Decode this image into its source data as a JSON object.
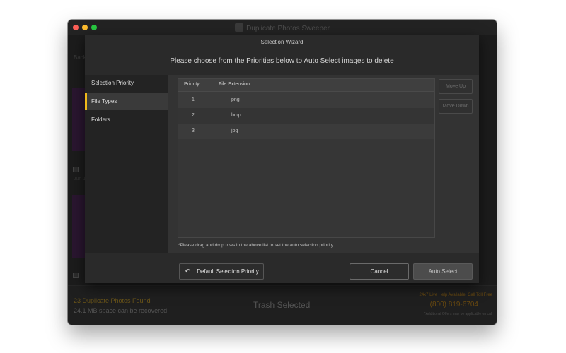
{
  "window": {
    "app_title": "Duplicate Photos Sweeper"
  },
  "background": {
    "back_label": "Back",
    "date_label": "Jun 1",
    "footer": {
      "found": "23 Duplicate Photos Found",
      "space": "24.1 MB space can be recovered",
      "trash": "Trash Selected",
      "help": "24x7 Live Help Available, Call Toll Free",
      "phone": "(800) 819-6704",
      "offer": "*Additional Offers may be applicable on call"
    }
  },
  "wizard": {
    "title": "Selection Wizard",
    "heading": "Please choose from the Priorities below to Auto Select images to delete",
    "sidebar_items": [
      {
        "label": "Selection Priority"
      },
      {
        "label": "File Types"
      },
      {
        "label": "Folders"
      }
    ],
    "active_item": "File Types",
    "table": {
      "headers": [
        "Priority",
        "File Extension"
      ],
      "rows": [
        {
          "priority": "1",
          "ext": "png"
        },
        {
          "priority": "2",
          "ext": "bmp"
        },
        {
          "priority": "3",
          "ext": "jpg"
        }
      ]
    },
    "move_up_label": "Move Up",
    "move_down_label": "Move Down",
    "note": "*Please drag and drop rows in the above list to set the auto selection priority",
    "default_priority_label": "Default Selection Priority",
    "cancel_label": "Cancel",
    "auto_select_label": "Auto Select"
  },
  "colors": {
    "accent": "#f0b81a",
    "close": "#fc5f57",
    "minimize": "#fdbc2e",
    "zoom": "#28c841"
  },
  "icons": {
    "back_arrow": "back-arrow-icon"
  }
}
